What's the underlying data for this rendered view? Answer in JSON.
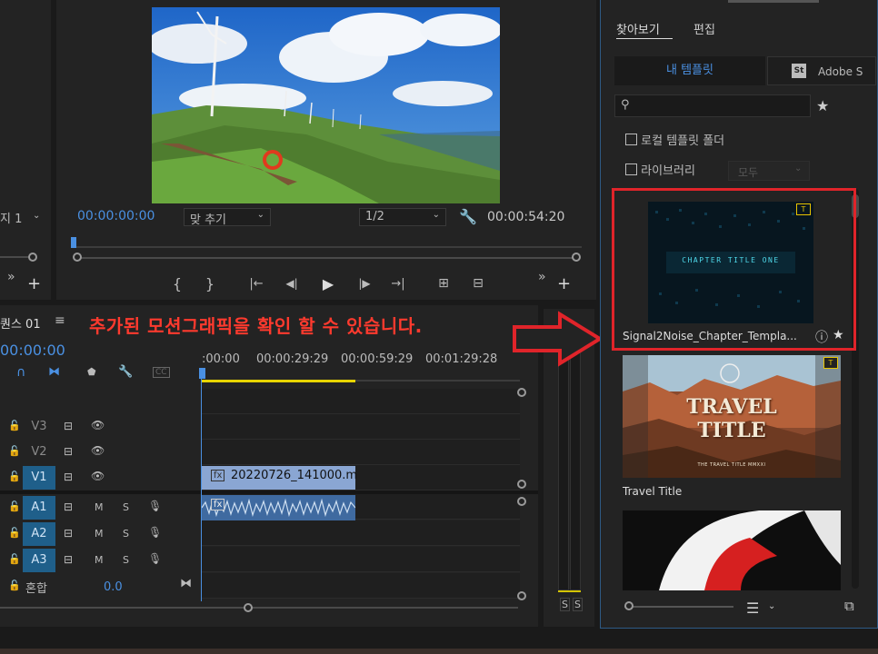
{
  "program_monitor": {
    "left_zoom_partial": "지 1",
    "timecode_current": "00:00:00:00",
    "fit_label": "맞 추기",
    "resolution": "1/2",
    "timecode_duration": "00:00:54:20",
    "controls": [
      "{",
      "}",
      "|←",
      "◀|",
      "▶",
      "|▶",
      "→|"
    ]
  },
  "timeline": {
    "sequence_name": "퀀스 01",
    "timecode": "00:00:00",
    "ruler_labels": [
      ":00:00",
      "00:00:29:29",
      "00:00:59:29",
      "00:01:29:28"
    ],
    "video_tracks": [
      "V3",
      "V2",
      "V1"
    ],
    "audio_tracks": [
      "A1",
      "A2",
      "A3"
    ],
    "mix_label": "혼합",
    "mix_value": "0.0",
    "clip_name": "20220726_141000.m",
    "m_label": "M",
    "s_label": "S"
  },
  "annotation": {
    "text": "추가된 모션그래픽을 확인 할 수 있습니다."
  },
  "essential_graphics": {
    "tabs": [
      "찾아보기",
      "편집"
    ],
    "segments": [
      "내 템플릿",
      "Adobe S"
    ],
    "search_placeholder": "",
    "local_folder_label": "로컬 템플릿 폴더",
    "libraries_label": "라이브러리",
    "libraries_dropdown": "모두",
    "templates": [
      {
        "name": "Signal2Noise_Chapter_Templa...",
        "preview_text": "CHAPTER TITLE ONE"
      },
      {
        "name": "Travel Title",
        "preview_text": "TRAVEL\nTITLE",
        "preview_sub": "THE TRAVEL TITLE MMXXI"
      },
      {
        "name": ""
      }
    ]
  },
  "meter": {
    "s_left": "S",
    "s_right": "S"
  },
  "colors": {
    "accent_blue": "#4a90e2",
    "annotation_red": "#e0242a",
    "track_on": "#1f5f8a"
  }
}
